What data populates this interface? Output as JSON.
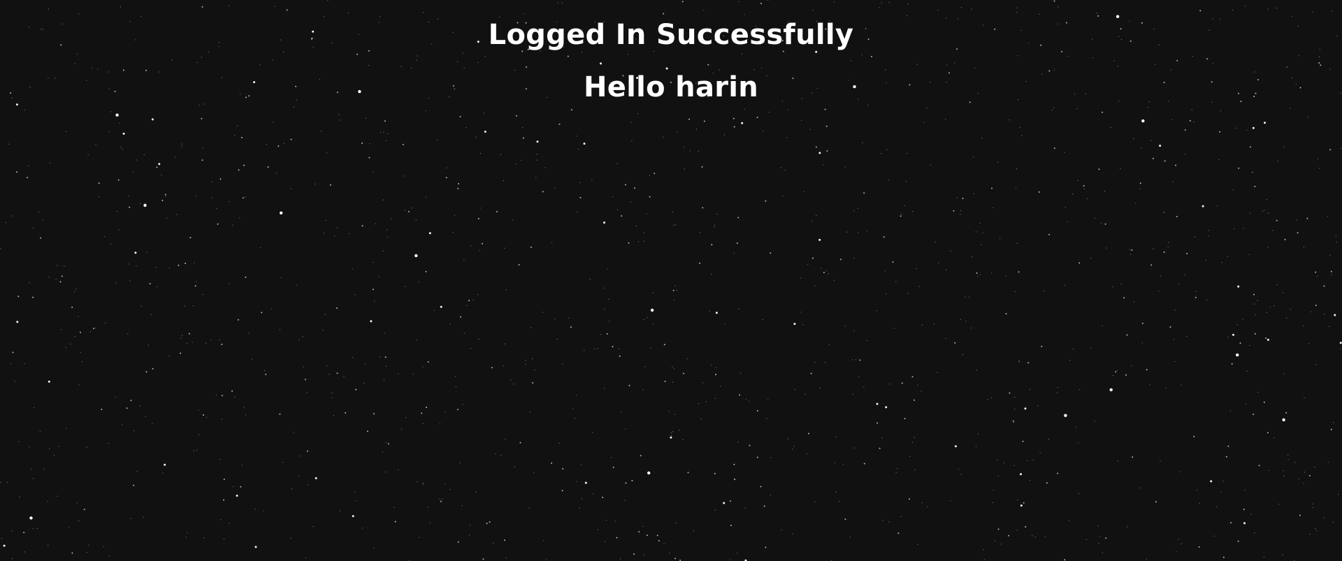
{
  "page": {
    "background_color": "#111111",
    "text_color": "#ffffff",
    "background_style": "starfield"
  },
  "heading": {
    "title": "Logged In Successfully",
    "greeting": "Hello harin"
  }
}
